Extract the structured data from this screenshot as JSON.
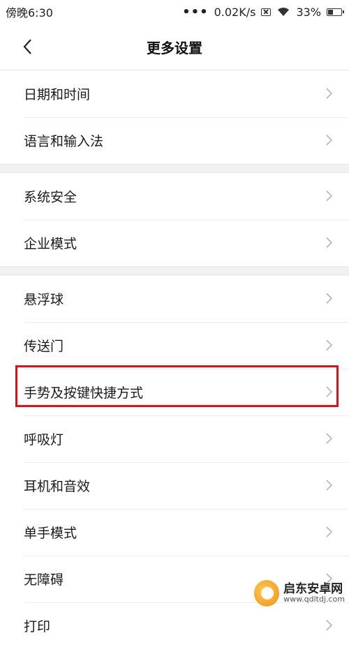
{
  "status_bar": {
    "time": "傍晚6:30",
    "dots": "•••",
    "speed": "0.02K/s",
    "battery": "33%"
  },
  "header": {
    "title": "更多设置"
  },
  "groups": [
    {
      "items": [
        {
          "label": "日期和时间"
        },
        {
          "label": "语言和输入法"
        }
      ]
    },
    {
      "items": [
        {
          "label": "系统安全"
        },
        {
          "label": "企业模式"
        }
      ]
    },
    {
      "items": [
        {
          "label": "悬浮球"
        },
        {
          "label": "传送门"
        },
        {
          "label": "手势及按键快捷方式"
        },
        {
          "label": "呼吸灯"
        },
        {
          "label": "耳机和音效"
        },
        {
          "label": "单手模式"
        },
        {
          "label": "无障碍"
        },
        {
          "label": "打印"
        }
      ]
    }
  ],
  "highlighted_item": "手势及按键快捷方式",
  "watermark": {
    "name": "启东安卓网",
    "url": "www.qdltdj.com"
  },
  "colors": {
    "highlight": "#d9121b",
    "background": "#ffffff",
    "group_gap": "#f1f1f1"
  }
}
